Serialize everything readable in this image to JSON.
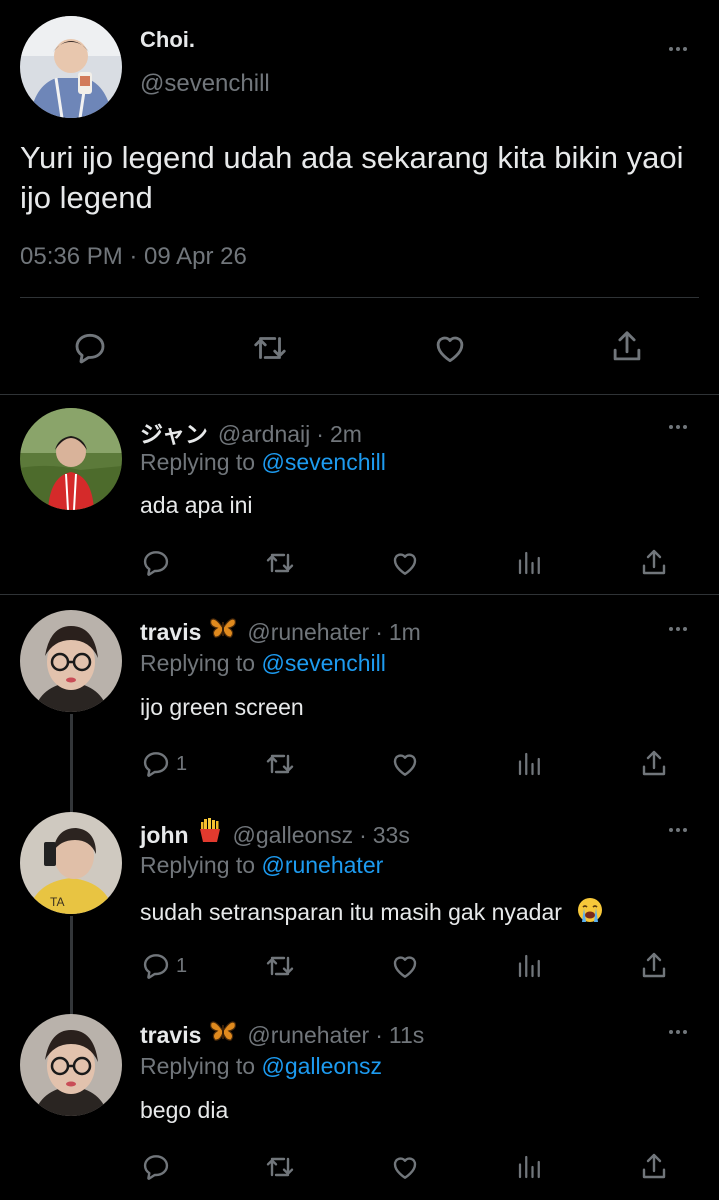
{
  "main_tweet": {
    "name": "Choi.",
    "handle": "@sevenchill",
    "text": "Yuri ijo legend udah ada sekarang kita bikin yaoi ijo legend",
    "timestamp": "05:36 PM · 09 Apr 26"
  },
  "replies": [
    {
      "name": "ジャン",
      "name_emoji": "",
      "handle": "@ardnaij",
      "dot": "·",
      "time": "2m",
      "replying_prefix": "Replying to ",
      "replying_to": "@sevenchill",
      "text": "ada apa ini",
      "reply_count": ""
    },
    {
      "name": "travis",
      "name_emoji": "butterfly",
      "handle": "@runehater",
      "dot": "·",
      "time": "1m",
      "replying_prefix": "Replying to ",
      "replying_to": "@sevenchill",
      "text": "ijo green screen",
      "reply_count": "1"
    },
    {
      "name": "john",
      "name_emoji": "fries",
      "handle": "@galleonsz",
      "dot": "·",
      "time": "33s",
      "replying_prefix": "Replying to ",
      "replying_to": "@runehater",
      "text": "sudah setransparan itu masih gak nyadar",
      "text_emoji": "loudly-crying-face",
      "reply_count": "1"
    },
    {
      "name": "travis",
      "name_emoji": "butterfly",
      "handle": "@runehater",
      "dot": "·",
      "time": "11s",
      "replying_prefix": "Replying to ",
      "replying_to": "@galleonsz",
      "text": "bego dia",
      "reply_count": ""
    }
  ],
  "colors": {
    "background": "#000000",
    "text_primary": "#e7e9ea",
    "text_secondary": "#71767b",
    "accent": "#1d9bf0",
    "divider": "#2f3336"
  },
  "icons": [
    "reply-icon",
    "retweet-icon",
    "like-icon",
    "views-icon",
    "share-icon",
    "more-icon"
  ]
}
